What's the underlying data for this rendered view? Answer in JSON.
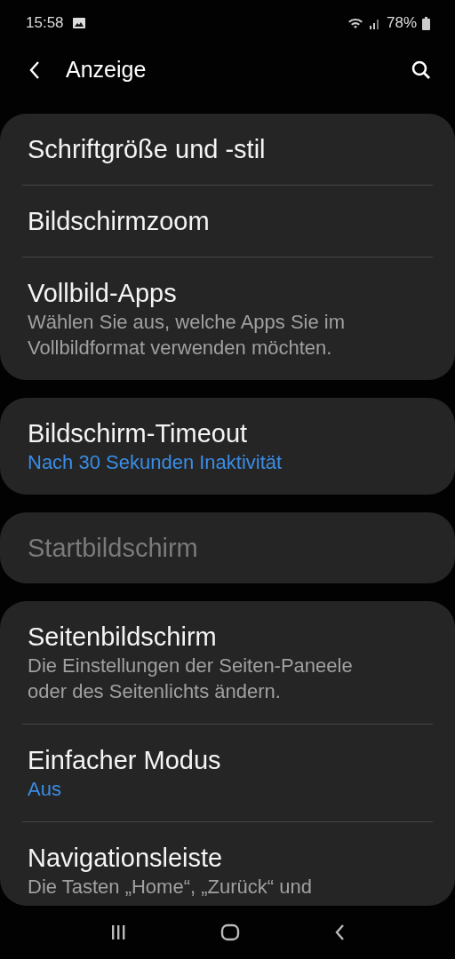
{
  "status_bar": {
    "time": "15:58",
    "battery": "78%"
  },
  "header": {
    "title": "Anzeige"
  },
  "groups": [
    {
      "items": [
        {
          "title": "Schriftgröße und -stil",
          "disabled": false
        },
        {
          "title": "Bildschirmzoom",
          "disabled": false
        },
        {
          "title": "Vollbild-Apps",
          "summary": "Wählen Sie aus, welche Apps Sie im Vollbildformat verwenden möchten.",
          "kind": "description",
          "disabled": false
        }
      ]
    },
    {
      "items": [
        {
          "title": "Bildschirm-Timeout",
          "summary": "Nach 30 Sekunden Inaktivität",
          "kind": "value",
          "disabled": false
        }
      ]
    },
    {
      "items": [
        {
          "title": "Startbildschirm",
          "disabled": true
        }
      ]
    },
    {
      "items": [
        {
          "title": "Seitenbildschirm",
          "summary": "Die Einstellungen der Seiten-Paneele oder des Seitenlichts ändern.",
          "kind": "description",
          "disabled": false
        },
        {
          "title": "Einfacher Modus",
          "summary": "Aus",
          "kind": "value",
          "disabled": false
        },
        {
          "title": "Navigationsleiste",
          "summary": "Die Tasten „Home“, „Zurück“ und",
          "kind": "description",
          "disabled": false
        }
      ]
    }
  ]
}
